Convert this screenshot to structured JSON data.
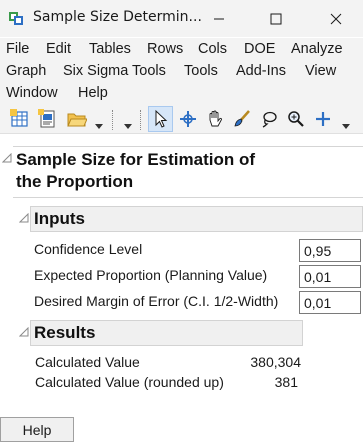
{
  "window": {
    "title": "Sample Size Determin...",
    "app_icon": "jmp-app-icon",
    "controls": [
      "minimize-icon",
      "maximize-icon",
      "close-icon"
    ]
  },
  "menu": {
    "items": [
      "File",
      "Edit",
      "Tables",
      "Rows",
      "Cols",
      "DOE",
      "Analyze",
      "Graph",
      "Six Sigma Tools",
      "Tools",
      "Add-Ins",
      "View",
      "Window",
      "Help"
    ]
  },
  "toolbar": {
    "icons": [
      "new-data-table-icon",
      "new-script-icon",
      "open-file-icon",
      "arrow-cursor-icon",
      "crosshair-icon",
      "hand-icon",
      "brush-icon",
      "lasso-icon",
      "magnifier-icon",
      "plus-icon"
    ],
    "selected": "arrow-cursor-icon"
  },
  "report": {
    "title": "Sample Size for Estimation of the Proportion",
    "inputs": {
      "header": "Inputs",
      "fields": [
        {
          "label": "Confidence Level",
          "value": "0,95"
        },
        {
          "label": "Expected Proportion (Planning Value)",
          "value": "0,01"
        },
        {
          "label": "Desired Margin of Error (C.I. 1/2-Width)",
          "value": "0,01"
        }
      ]
    },
    "results": {
      "header": "Results",
      "rows": [
        {
          "label": "Calculated Value",
          "value": "380,304"
        },
        {
          "label": "Calculated Value (rounded up)",
          "value": "381"
        }
      ]
    }
  },
  "footer": {
    "help_label": "Help"
  },
  "colors": {
    "chrome": "#f3f3f3",
    "header_fill": "#f0f0f0",
    "selected_tool": "#d6e6f8",
    "outline_triangle": "#8a8a8a"
  }
}
